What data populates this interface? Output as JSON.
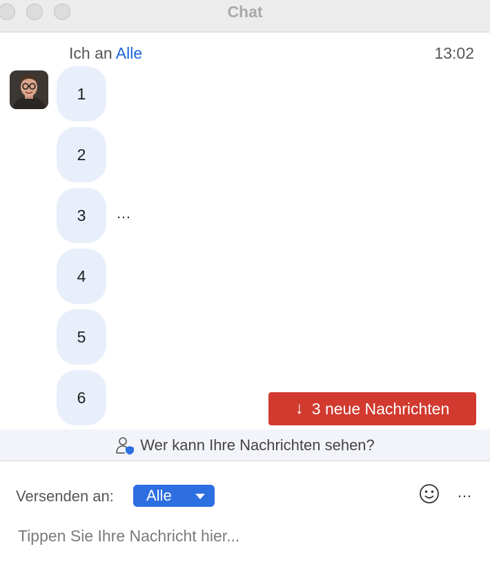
{
  "window": {
    "title": "Chat"
  },
  "message_header": {
    "sender": "Ich an",
    "recipient": "Alle",
    "time": "13:02"
  },
  "messages": [
    {
      "text": "1"
    },
    {
      "text": "2"
    },
    {
      "text": "3"
    },
    {
      "text": "4"
    },
    {
      "text": "5"
    },
    {
      "text": "6"
    }
  ],
  "message_more": "…",
  "new_messages_button": {
    "label": "3 neue Nachrichten",
    "arrow": "↓"
  },
  "visibility_notice": "Wer kann Ihre Nachrichten sehen?",
  "send_to": {
    "label": "Versenden an:",
    "value": "Alle"
  },
  "toolbar": {
    "more": "…"
  },
  "compose": {
    "placeholder": "Tippen Sie Ihre Nachricht hier..."
  },
  "colors": {
    "accent": "#2d6fe0",
    "link": "#1a63d9",
    "alert": "#d2392f",
    "bubble": "#e8effb"
  }
}
